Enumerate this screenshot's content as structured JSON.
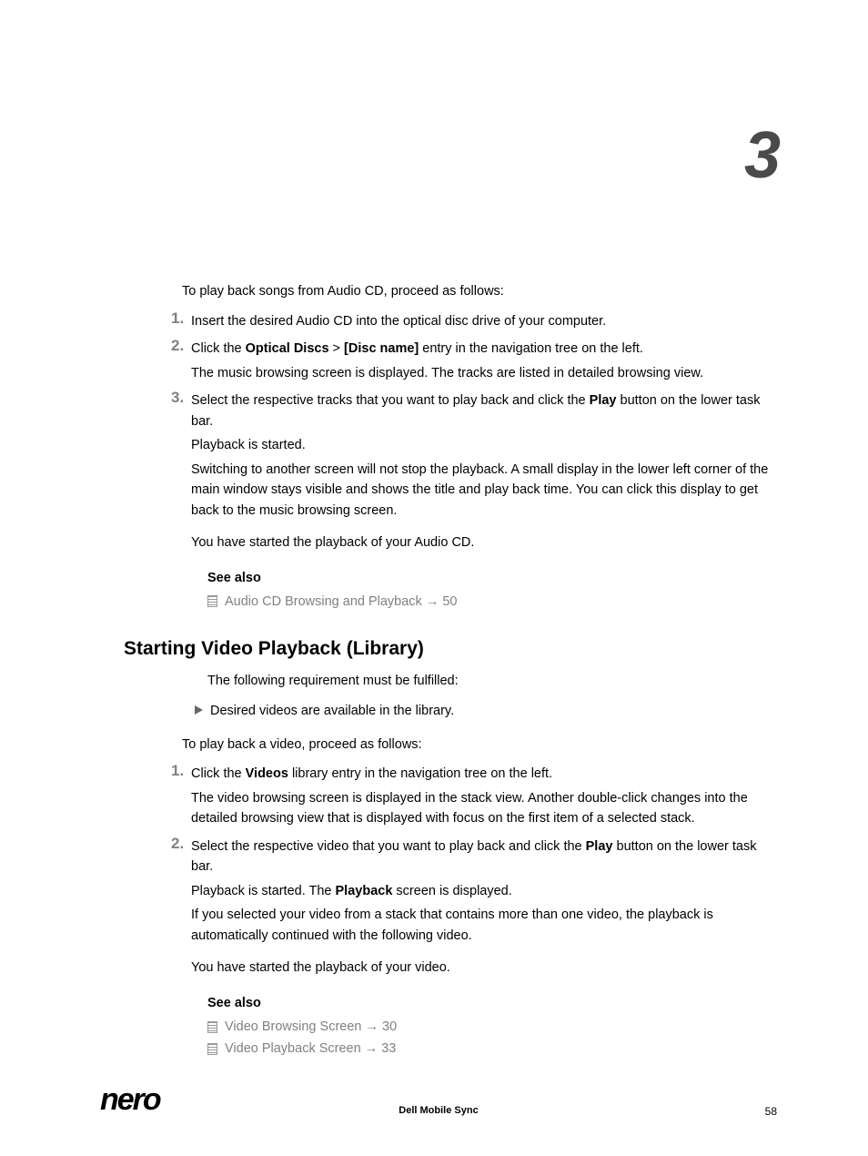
{
  "chapter_number": "3",
  "section1": {
    "intro": "To play back songs from Audio CD, proceed as follows:",
    "step1": {
      "num": "1.",
      "text": "Insert the desired Audio CD into the optical disc drive of your computer."
    },
    "step2": {
      "num": "2.",
      "text_a": "Click the ",
      "bold_a": "Optical Discs",
      "text_b": " > ",
      "bold_b": "[Disc name]",
      "text_c": " entry in the navigation tree on the left.",
      "sub": "The music browsing screen is displayed. The tracks are listed in detailed browsing view."
    },
    "step3": {
      "num": "3.",
      "text_a": "Select the respective tracks that you want to play back and click the ",
      "bold_a": "Play",
      "text_b": " button on the lower task bar.",
      "sub1": "Playback is started.",
      "sub2": "Switching to another screen will not stop the playback. A small display in the lower left corner of the main window stays visible and shows the title and play back time. You can click this display to get back to the music browsing screen."
    },
    "result": "You have started the playback of your Audio CD.",
    "see_also_label": "See also",
    "see_also_item1": "Audio CD Browsing and Playback → 50"
  },
  "section2": {
    "heading": "Starting Video Playback (Library)",
    "requirement_intro": "The following requirement must be fulfilled:",
    "requirement_item": "Desired videos are available in the library.",
    "intro": "To play back a video, proceed as follows:",
    "step1": {
      "num": "1.",
      "text_a": "Click the ",
      "bold_a": "Videos",
      "text_b": " library entry in the navigation tree on the left.",
      "sub": "The video browsing screen is displayed in the stack view. Another double-click changes into the detailed browsing view that is displayed with focus on the first item of a selected stack."
    },
    "step2": {
      "num": "2.",
      "text_a": "Select the respective video that you want to play back and click the ",
      "bold_a": "Play",
      "text_b": " button on the lower task bar.",
      "sub1_a": "Playback is started. The ",
      "sub1_bold": "Playback",
      "sub1_b": " screen is displayed.",
      "sub2": "If you selected your video from a stack that contains more than one video, the playback is automatically continued with the following video."
    },
    "result": "You have started the playback of your video.",
    "see_also_label": "See also",
    "see_also_item1": "Video Browsing Screen → 30",
    "see_also_item2": "Video Playback Screen → 33"
  },
  "footer": {
    "logo": "nero",
    "title": "Dell Mobile Sync",
    "page": "58"
  }
}
